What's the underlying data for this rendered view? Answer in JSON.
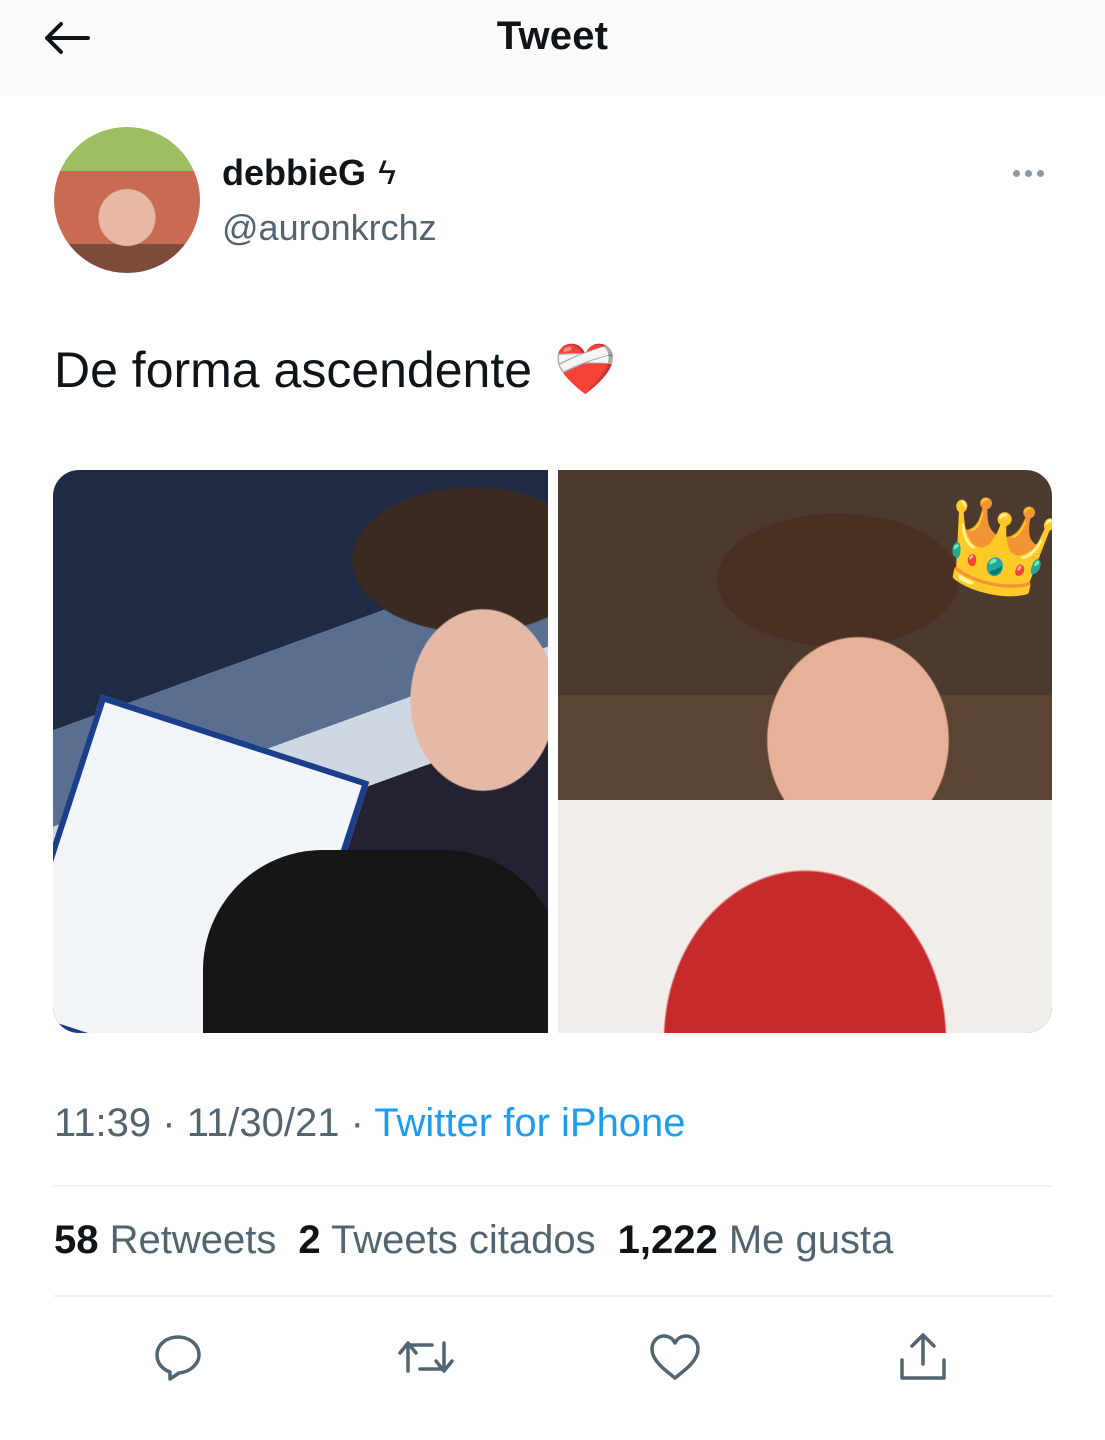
{
  "header": {
    "title": "Tweet",
    "back_icon": "arrow-left-icon"
  },
  "author": {
    "display_name": "debbieG",
    "name_glyph": "ϟ",
    "handle": "@auronkrchz"
  },
  "tweet": {
    "text": "De forma ascendente",
    "emoji": "❤️‍🩹",
    "crown_emoji": "👑"
  },
  "meta": {
    "time": "11:39",
    "separator": "·",
    "date": "11/30/21",
    "source": "Twitter for iPhone"
  },
  "stats": {
    "retweets_count": "58",
    "retweets_label": "Retweets",
    "quotes_count": "2",
    "quotes_label": "Tweets citados",
    "likes_count": "1,222",
    "likes_label": "Me gusta"
  },
  "actions": [
    "reply-icon",
    "retweet-icon",
    "like-icon",
    "share-icon"
  ],
  "colors": {
    "text": "#0f1419",
    "secondary": "#536471",
    "link": "#1d9bf0",
    "divider": "#eff3f4"
  }
}
